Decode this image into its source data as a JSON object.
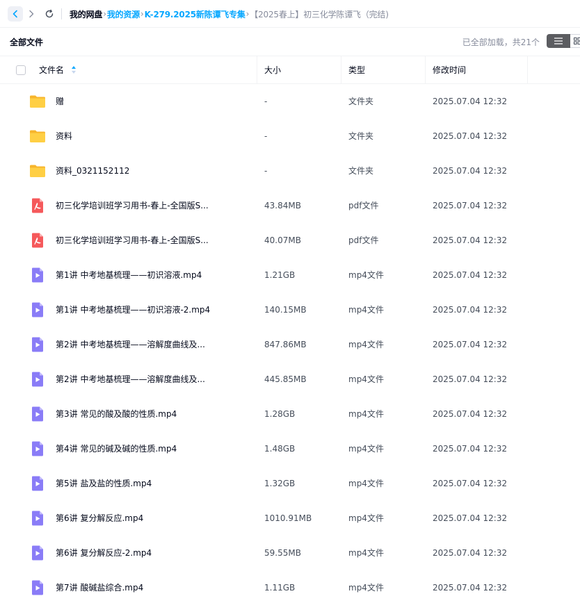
{
  "nav": {
    "breadcrumbs": [
      {
        "label": "我的网盘",
        "style": "root"
      },
      {
        "label": "我的资源",
        "style": "link"
      },
      {
        "label": "K-279.2025新陈谭飞专集",
        "style": "link"
      },
      {
        "label": "【2025春上】初三化学陈谭飞（完结)",
        "style": "current"
      }
    ],
    "separator": "›"
  },
  "toolbar": {
    "title": "全部文件",
    "load_status": "已全部加载，共21个"
  },
  "table": {
    "columns": {
      "name": "文件名",
      "size": "大小",
      "type": "类型",
      "modified": "修改时间"
    },
    "rows": [
      {
        "icon": "folder-icon",
        "name": "赠",
        "size": "-",
        "type": "文件夹",
        "modified": "2025.07.04 12:32"
      },
      {
        "icon": "folder-icon",
        "name": "资料",
        "size": "-",
        "type": "文件夹",
        "modified": "2025.07.04 12:32"
      },
      {
        "icon": "folder-icon",
        "name": "资料_0321152112",
        "size": "-",
        "type": "文件夹",
        "modified": "2025.07.04 12:32"
      },
      {
        "icon": "pdf-icon",
        "name": "初三化学培训班学习用书-春上-全国版S...",
        "size": "43.84MB",
        "type": "pdf文件",
        "modified": "2025.07.04 12:32"
      },
      {
        "icon": "pdf-icon",
        "name": "初三化学培训班学习用书-春上-全国版S...",
        "size": "40.07MB",
        "type": "pdf文件",
        "modified": "2025.07.04 12:32"
      },
      {
        "icon": "video-icon",
        "name": "第1讲 中考地基梳理——初识溶液.mp4",
        "size": "1.21GB",
        "type": "mp4文件",
        "modified": "2025.07.04 12:32"
      },
      {
        "icon": "video-icon",
        "name": "第1讲 中考地基梳理——初识溶液-2.mp4",
        "size": "140.15MB",
        "type": "mp4文件",
        "modified": "2025.07.04 12:32"
      },
      {
        "icon": "video-icon",
        "name": "第2讲 中考地基梳理——溶解度曲线及...",
        "size": "847.86MB",
        "type": "mp4文件",
        "modified": "2025.07.04 12:32"
      },
      {
        "icon": "video-icon",
        "name": "第2讲 中考地基梳理——溶解度曲线及...",
        "size": "445.85MB",
        "type": "mp4文件",
        "modified": "2025.07.04 12:32"
      },
      {
        "icon": "video-icon",
        "name": "第3讲 常见的酸及酸的性质.mp4",
        "size": "1.28GB",
        "type": "mp4文件",
        "modified": "2025.07.04 12:32"
      },
      {
        "icon": "video-icon",
        "name": "第4讲 常见的碱及碱的性质.mp4",
        "size": "1.48GB",
        "type": "mp4文件",
        "modified": "2025.07.04 12:32"
      },
      {
        "icon": "video-icon",
        "name": "第5讲 盐及盐的性质.mp4",
        "size": "1.32GB",
        "type": "mp4文件",
        "modified": "2025.07.04 12:32"
      },
      {
        "icon": "video-icon",
        "name": "第6讲 复分解反应.mp4",
        "size": "1010.91MB",
        "type": "mp4文件",
        "modified": "2025.07.04 12:32"
      },
      {
        "icon": "video-icon",
        "name": "第6讲 复分解反应-2.mp4",
        "size": "59.55MB",
        "type": "mp4文件",
        "modified": "2025.07.04 12:32"
      },
      {
        "icon": "video-icon",
        "name": "第7讲 酸碱盐综合.mp4",
        "size": "1.11GB",
        "type": "mp4文件",
        "modified": "2025.07.04 12:32"
      }
    ]
  },
  "colors": {
    "accent": "#06a7ff",
    "folder": "#ffc83d",
    "pdf": "#f5595b",
    "video": "#8a7cf7"
  }
}
